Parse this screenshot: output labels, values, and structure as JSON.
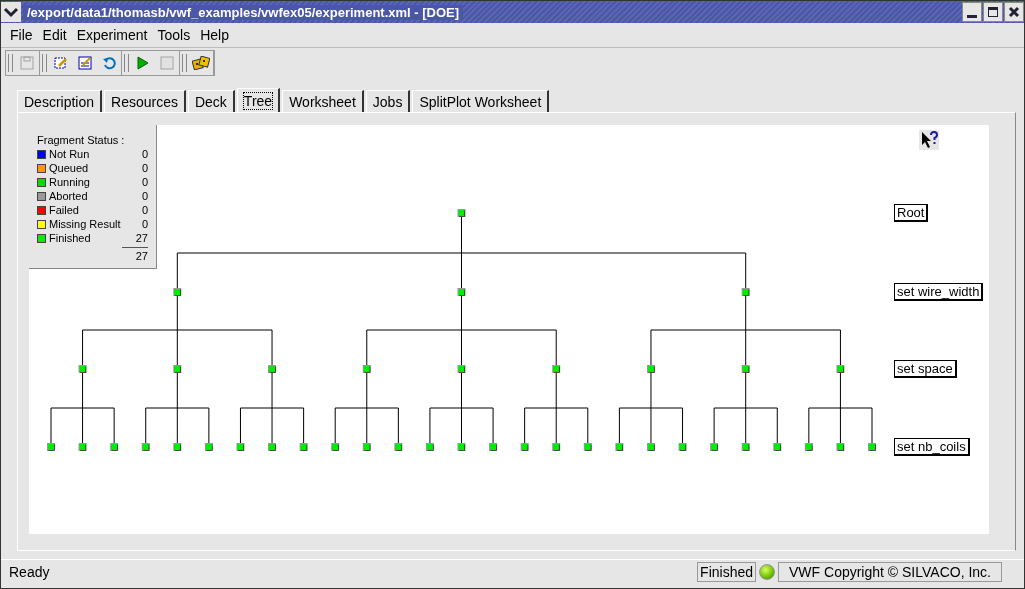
{
  "window": {
    "title": "/export/data1/thomasb/vwf_examples/vwfex05/experiment.xml - [DOE]"
  },
  "menu": [
    "File",
    "Edit",
    "Experiment",
    "Tools",
    "Help"
  ],
  "toolbar": [
    [
      {
        "kind": "save",
        "disabled": true
      }
    ],
    [
      {
        "kind": "edit",
        "disabled": false
      },
      {
        "kind": "check",
        "disabled": false
      },
      {
        "kind": "reload",
        "disabled": false
      }
    ],
    [
      {
        "kind": "run",
        "disabled": false
      },
      {
        "kind": "stop",
        "disabled": true
      }
    ],
    [
      {
        "kind": "dice",
        "disabled": false
      }
    ]
  ],
  "tabs": [
    {
      "label": "Description",
      "selected": false
    },
    {
      "label": "Resources",
      "selected": false
    },
    {
      "label": "Deck",
      "selected": false
    },
    {
      "label": "Tree",
      "selected": true
    },
    {
      "label": "Worksheet",
      "selected": false
    },
    {
      "label": "Jobs",
      "selected": false
    },
    {
      "label": "SplitPlot Worksheet",
      "selected": false
    }
  ],
  "fragment_status": {
    "title": "Fragment Status :",
    "items": [
      {
        "label": "Not Run",
        "count": "0",
        "color": "#0000ff"
      },
      {
        "label": "Queued",
        "count": "0",
        "color": "#ff9900"
      },
      {
        "label": "Running",
        "count": "0",
        "color": "#00dd00"
      },
      {
        "label": "Aborted",
        "count": "0",
        "color": "#999999"
      },
      {
        "label": "Failed",
        "count": "0",
        "color": "#ff0000"
      },
      {
        "label": "Missing Result",
        "count": "0",
        "color": "#ffff00"
      },
      {
        "label": "Finished",
        "count": "27",
        "color": "#00ee00"
      }
    ],
    "total": "27"
  },
  "tree": {
    "levels": [
      {
        "label": "Root"
      },
      {
        "label": "set wire_width"
      },
      {
        "label": "set space"
      },
      {
        "label": "set nb_coils"
      }
    ]
  },
  "status_bar": {
    "message": "Ready",
    "state": "Finished",
    "copyright": "VWF Copyright ©  SILVACO, Inc."
  }
}
